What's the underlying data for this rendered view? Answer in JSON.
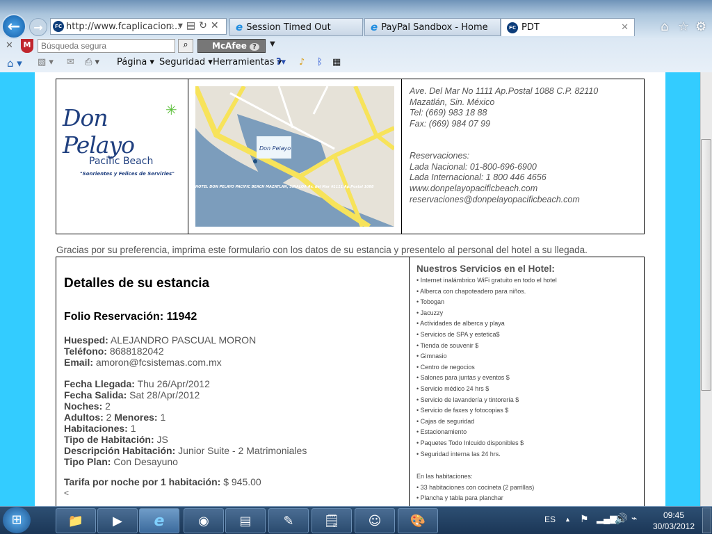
{
  "browser": {
    "address": "http://www.fcaplicacion...",
    "tabs": [
      {
        "label": "Session Timed Out",
        "icon": "ie-icon"
      },
      {
        "label": "PayPal Sandbox - Home",
        "icon": "ie-icon"
      },
      {
        "label": "PDT",
        "icon": "fc-icon",
        "active": true
      }
    ],
    "search_placeholder": "Búsqueda segura",
    "mcafee_label": "McAfee",
    "menus": [
      "Página",
      "Seguridad",
      "Herramientas"
    ]
  },
  "header": {
    "logo_text": "Don Pelayo",
    "logo_sub": "Pacific Beach",
    "logo_slogan": "\"Sonrientes y Felices de Servirles\"",
    "map_caption": "HOTEL DON PELAYO PACIFIC BEACH MAZATLAN, SINALOA Av. del Mar #1111 Ap.Postal 1088",
    "address_lines": [
      "Ave. Del Mar No 1111 Ap.Postal 1088 C.P. 82110",
      "Mazatlán, Sin. México",
      "Tel: (669) 983 18 88",
      "Fax: (669) 984 07 99"
    ],
    "reservation_lines": [
      "Reservaciones:",
      "Lada Nacional: 01-800-696-6900",
      "Lada Internacional: 1 800 446 4656",
      "www.donpelayopacificbeach.com",
      "reservaciones@donpelayopacificbeach.com"
    ]
  },
  "thanks": "Gracias por su preferencia, imprima este formulario con los datos de su estancia y presentelo al personal del hotel a su llegada.",
  "details": {
    "title": "Detalles de su estancia",
    "folio_label": "Folio Reservación:",
    "folio": "11942",
    "group1": [
      {
        "k": "Huesped:",
        "v": "ALEJANDRO PASCUAL MORON"
      },
      {
        "k": "Teléfono:",
        "v": "8688182042"
      },
      {
        "k": "Email:",
        "v": "amoron@fcsistemas.com.mx"
      }
    ],
    "group2": [
      {
        "k": "Fecha Llegada:",
        "v": "Thu 26/Apr/2012"
      },
      {
        "k": "Fecha Salida:",
        "v": "Sat 28/Apr/2012"
      },
      {
        "k": "Noches:",
        "v": "2"
      },
      {
        "k": "Adultos:",
        "v": "2",
        "k2": "Menores:",
        "v2": "1"
      },
      {
        "k": "Habitaciones:",
        "v": "1"
      },
      {
        "k": "Tipo de Habitación:",
        "v": "JS"
      },
      {
        "k": "Descripción Habitación:",
        "v": "Junior Suite - 2 Matrimoniales"
      },
      {
        "k": "Tipo Plan:",
        "v": "Con Desayuno"
      }
    ],
    "rate_label": "Tarifa por noche por 1 habitación:",
    "rate": "$ 945.00",
    "trailing": "<"
  },
  "services": {
    "title": "Nuestros Servicios en el Hotel:",
    "items": [
      "• Internet inalámbrico WiFi gratuito en todo el hotel",
      "• Alberca con chapoteadero para niños.",
      "• Tobogan",
      "• Jacuzzy",
      "• Actividades de alberca y playa",
      "• Servicios de SPA y estetica$",
      "• Tienda de souvenir $",
      "• Gimnasio",
      "• Centro de negocios",
      "• Salones para juntas y eventos $",
      "• Servicio médico 24 hrs $",
      "• Servicio de lavandería y tintorería $",
      "• Servicio de faxes y fotocopias $",
      "• Cajas de seguridad",
      "• Estacionamiento",
      "• Paquetes Todo Inlcuido disponibles $",
      "• Seguridad interna las 24 hrs."
    ],
    "rooms_title": "En las habitaciones:",
    "room_items": [
      "• 33 habitaciones con cocineta (2 parrillas)",
      "• Plancha y tabla para planchar"
    ]
  },
  "taskbar": {
    "lang": "ES",
    "time": "09:45",
    "date": "30/03/2012"
  },
  "colors": {
    "page_side": "#33ccff",
    "logo_blue": "#1f3f7f",
    "logo_green": "#5bbf3a"
  }
}
